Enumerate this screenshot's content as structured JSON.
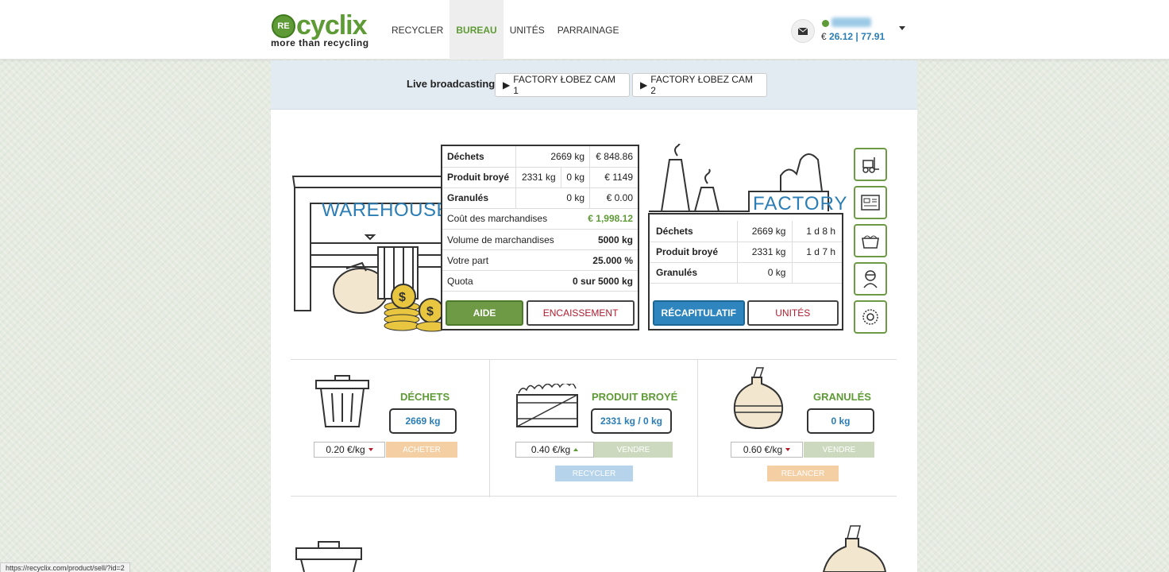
{
  "header": {
    "logo_mark": "RE",
    "logo_name": "cyclix",
    "tagline": "more than recycling",
    "nav": [
      "RECYCLER",
      "BUREAU",
      "UNITÉS",
      "PARRAINAGE"
    ],
    "active_nav": "BUREAU",
    "balance_prefix": "€",
    "balance": "26.12 | 77.91",
    "icons": {
      "mail": "mail-icon",
      "dropdown": "chevron-down-icon"
    }
  },
  "live": {
    "label": "Live broadcasting",
    "cam1": "FACTORY ŁOBEZ CAM 1",
    "cam2": "FACTORY ŁOBEZ CAM 2",
    "play_glyph": "▶"
  },
  "warehouse": {
    "title": "WAREHOUSE",
    "rows": [
      {
        "label": "Déchets",
        "qty": "2669 kg",
        "value": "€ 848.86"
      },
      {
        "label": "Produit broyé",
        "qty": "2331 kg",
        "qty2": "0 kg",
        "value": "€ 1149"
      },
      {
        "label": "Granulés",
        "qty": "0 kg",
        "value": "€ 0.00"
      }
    ],
    "stats": [
      {
        "label": "Coût des marchandises",
        "value": "€ 1,998.12"
      },
      {
        "label": "Volume de marchandises",
        "value": "5000 kg"
      },
      {
        "label": "Votre part",
        "value": "25.000 %"
      },
      {
        "label": "Quota",
        "value": "0 sur 5000 kg"
      }
    ],
    "btn_help": "AIDE",
    "btn_cash": "ENCAISSEMENT"
  },
  "factory": {
    "title": "FACTORY",
    "rows": [
      {
        "label": "Déchets",
        "qty": "2669 kg",
        "time": "1 d 8 h"
      },
      {
        "label": "Produit broyé",
        "qty": "2331 kg",
        "time": "1 d 7 h"
      },
      {
        "label": "Granulés",
        "qty": "0 kg",
        "time": ""
      }
    ],
    "btn_recap": "RÉCAPITULATIF",
    "btn_units": "UNITÉS",
    "side_icons": [
      "forklift-icon",
      "machine-icon",
      "container-icon",
      "worker-icon",
      "gear-icon"
    ]
  },
  "products": [
    {
      "title": "DÉCHETS",
      "qty": "2669 kg",
      "price": "0.20 €/kg",
      "trend": "down",
      "action": "ACHETER",
      "action_color": "#f3cfa3",
      "icon": "trash-bin-icon"
    },
    {
      "title": "PRODUIT BROYÉ",
      "qty": "2331 kg / 0 kg",
      "price": "0.40 €/kg",
      "trend": "up",
      "action": "VENDRE",
      "action_color": "#cdd9bf",
      "secondary": "RECYCLER",
      "secondary_color": "#b5d3ea",
      "icon": "crate-icon"
    },
    {
      "title": "GRANULÉS",
      "qty": "0 kg",
      "price": "0.60 €/kg",
      "trend": "down",
      "action": "VENDRE",
      "action_color": "#cdd9bf",
      "secondary": "RELANCER",
      "secondary_color": "#f3cfa3",
      "icon": "sack-icon"
    }
  ],
  "status_url": "https://recyclix.com/product/sell/?id=2"
}
